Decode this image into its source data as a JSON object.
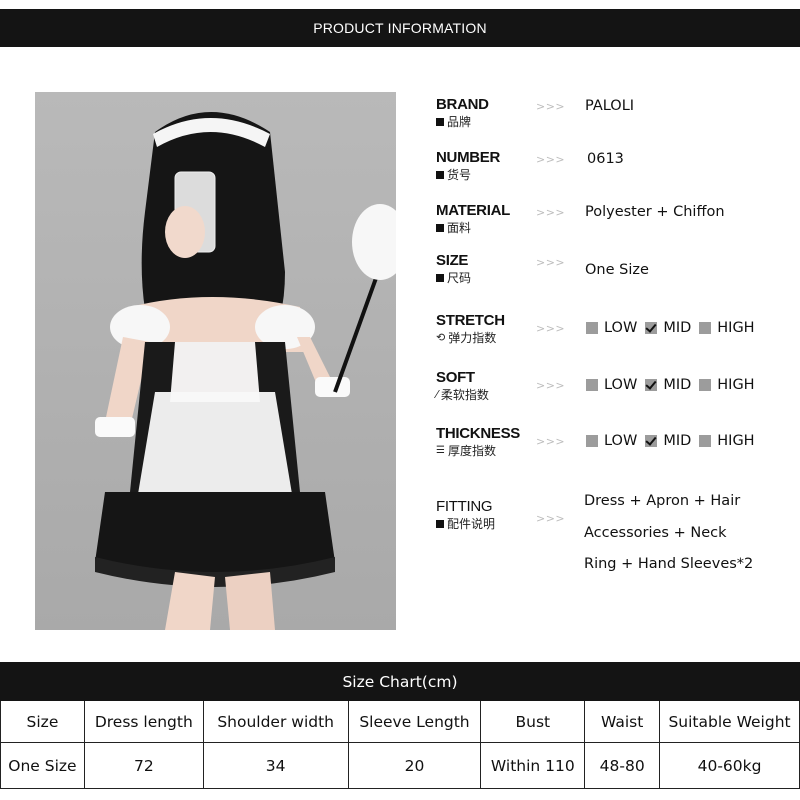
{
  "header": {
    "title": "PRODUCT INFORMATION"
  },
  "photo": {
    "description_icon": "product-photo"
  },
  "arrows": ">>>",
  "specs": {
    "brand": {
      "en": "BRAND",
      "cn": "品牌",
      "value": "PALOLI"
    },
    "number": {
      "en": "NUMBER",
      "cn": "货号",
      "value": "0613"
    },
    "material": {
      "en": "MATERIAL",
      "cn": "面料",
      "value": "Polyester + Chiffon"
    },
    "size": {
      "en": "SIZE",
      "cn": "尺码",
      "value": "One Size"
    },
    "stretch": {
      "en": "STRETCH",
      "cn": "弹力指数",
      "selected": "MID"
    },
    "soft": {
      "en": "SOFT",
      "cn": "柔软指数",
      "selected": "MID"
    },
    "thickness": {
      "en": "THICKNESS",
      "cn": "厚度指数",
      "selected": "MID"
    },
    "fitting": {
      "en": "FITTING",
      "cn": "配件说明",
      "lines": [
        "Dress + Apron + Hair",
        "Accessories + Neck",
        "Ring + Hand Sleeves*2"
      ]
    }
  },
  "scale_options": {
    "low": "LOW",
    "mid": "MID",
    "high": "HIGH"
  },
  "size_chart": {
    "title": "Size Chart(cm)",
    "columns": [
      "Size",
      "Dress length",
      "Shoulder width",
      "Sleeve Length",
      "Bust",
      "Waist",
      "Suitable Weight"
    ],
    "rows": [
      [
        "One Size",
        "72",
        "34",
        "20",
        "Within 110",
        "48-80",
        "40-60kg"
      ]
    ]
  }
}
